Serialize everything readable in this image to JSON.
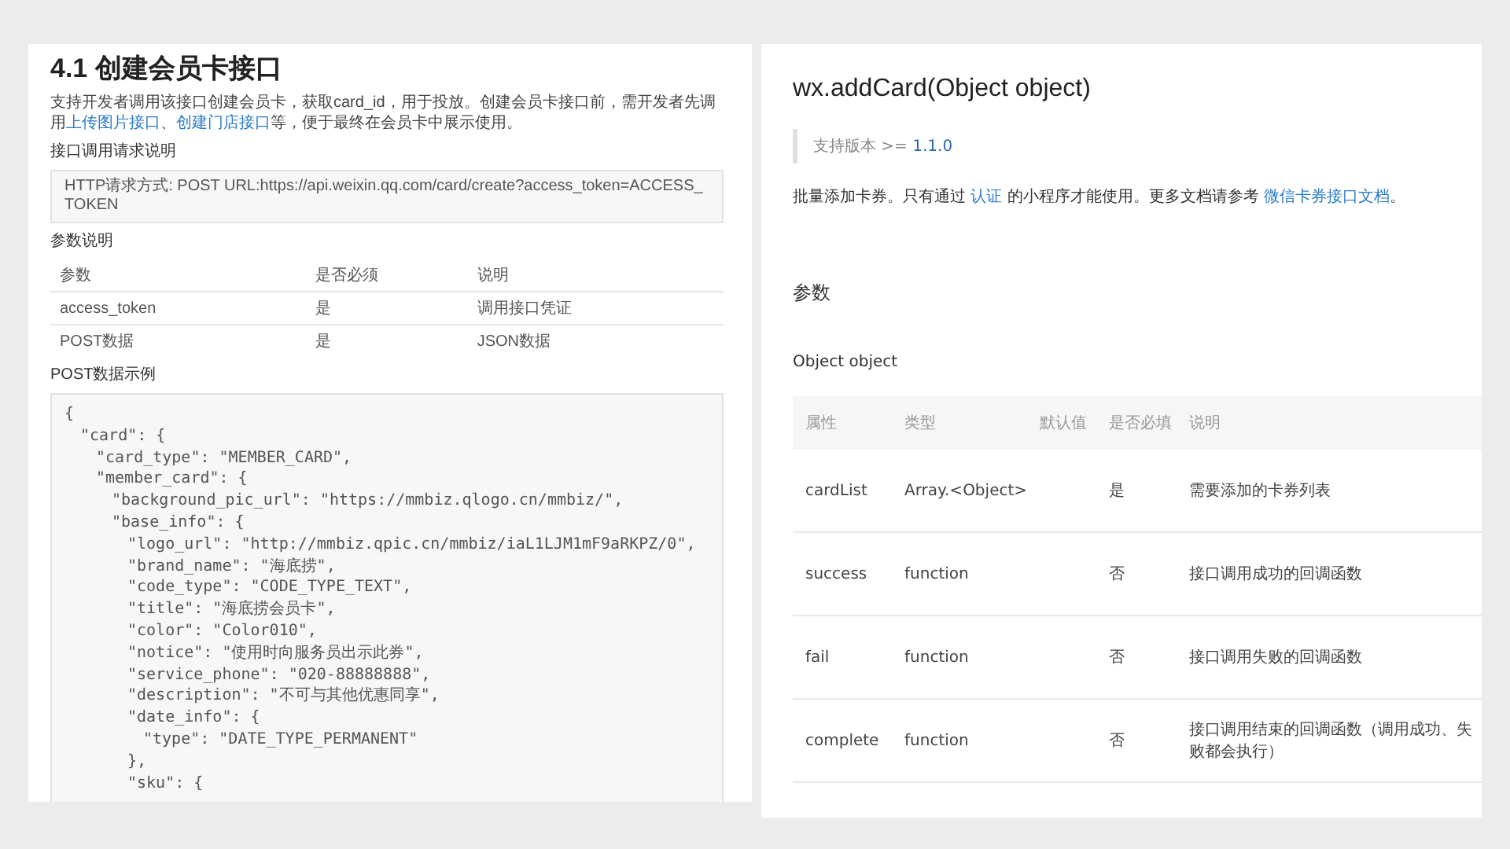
{
  "left_doc": {
    "title": "4.1 创建会员卡接口",
    "intro": [
      {
        "text": "支持开发者调用该接口创建会员卡，获取card_id，用于投放。创建会员卡接口前，需开发者先调用",
        "link": false
      },
      {
        "text": "上传图片接口",
        "link": true
      },
      {
        "text": "、",
        "link": false
      },
      {
        "text": "创建门店接口",
        "link": true
      },
      {
        "text": "等，便于最终在会员卡中展示使用。",
        "link": false
      }
    ],
    "request_heading": "接口调用请求说明",
    "request_line": "HTTP请求方式: POST URL:https://api.weixin.qq.com/card/create?access_token=ACCESS_TOKEN",
    "params_heading": "参数说明",
    "table": {
      "columns": [
        "参数",
        "是否必须",
        "说明"
      ],
      "rows": [
        [
          "access_token",
          "是",
          "调用接口凭证"
        ],
        [
          "POST数据",
          "是",
          "JSON数据"
        ]
      ]
    },
    "example_heading": "POST数据示例",
    "code": [
      {
        "text": "{",
        "children": [
          {
            "text": "\"card\": {",
            "children": [
              {
                "text": "\"card_type\": \"MEMBER_CARD\","
              },
              {
                "text": "\"member_card\": {",
                "children": [
                  {
                    "text": "\"background_pic_url\": \"https://mmbiz.qlogo.cn/mmbiz/\","
                  },
                  {
                    "text": "\"base_info\": {",
                    "children": [
                      {
                        "text": "\"logo_url\": \"http://mmbiz.qpic.cn/mmbiz/iaL1LJM1mF9aRKPZ/0\","
                      },
                      {
                        "text": "\"brand_name\": \"海底捞\","
                      },
                      {
                        "text": "\"code_type\": \"CODE_TYPE_TEXT\","
                      },
                      {
                        "text": "\"title\": \"海底捞会员卡\","
                      },
                      {
                        "text": "\"color\": \"Color010\","
                      },
                      {
                        "text": "\"notice\": \"使用时向服务员出示此券\","
                      },
                      {
                        "text": "\"service_phone\": \"020-88888888\","
                      },
                      {
                        "text": "\"description\": \"不可与其他优惠同享\","
                      },
                      {
                        "text": "\"date_info\": {",
                        "children": [
                          {
                            "text": "\"type\": \"DATE_TYPE_PERMANENT\""
                          }
                        ]
                      },
                      {
                        "text": "},"
                      },
                      {
                        "text": "\"sku\": {"
                      }
                    ]
                  }
                ]
              }
            ]
          }
        ]
      }
    ]
  },
  "right_doc": {
    "title": "wx.addCard(Object object)",
    "version": {
      "label": "支持版本 >=",
      "value": "1.1.0"
    },
    "intro": [
      {
        "text": "批量添加卡券。只有通过 ",
        "link": false
      },
      {
        "text": "认证",
        "link": true
      },
      {
        "text": " 的小程序才能使用。更多文档请参考 ",
        "link": false
      },
      {
        "text": "微信卡券接口文档",
        "link": true
      },
      {
        "text": "。",
        "link": false
      }
    ],
    "params_heading": "参数",
    "object_heading": "Object object",
    "table": {
      "columns": [
        "属性",
        "类型",
        "默认值",
        "是否必填",
        "说明"
      ],
      "rows": [
        [
          "cardList",
          "Array.<Object>",
          "",
          "是",
          "需要添加的卡券列表"
        ],
        [
          "success",
          "function",
          "",
          "否",
          "接口调用成功的回调函数"
        ],
        [
          "fail",
          "function",
          "",
          "否",
          "接口调用失败的回调函数"
        ],
        [
          "complete",
          "function",
          "",
          "否",
          "接口调用结束的回调函数（调用成功、失败都会执行）"
        ]
      ]
    }
  }
}
